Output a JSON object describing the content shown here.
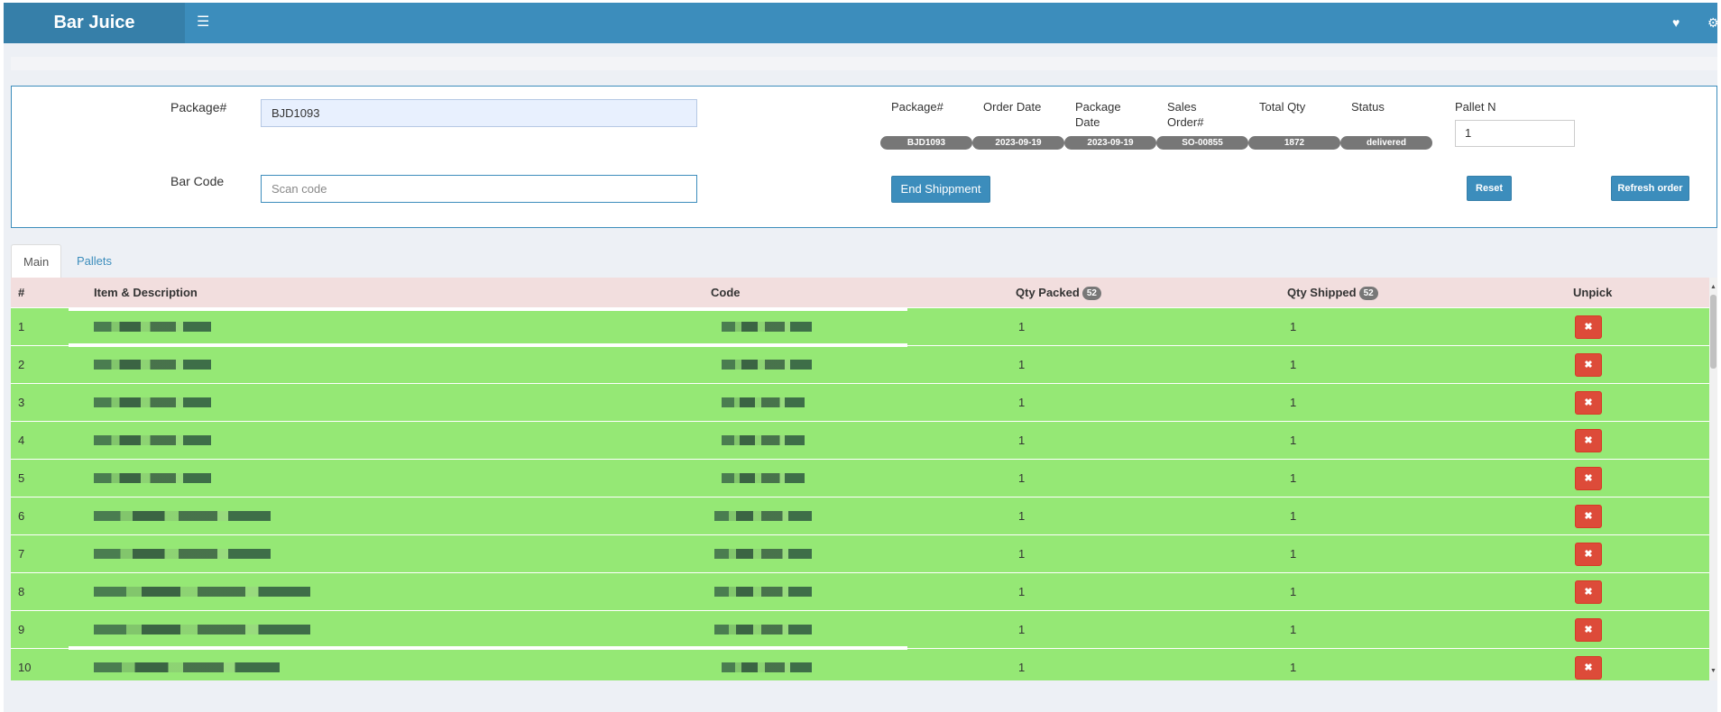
{
  "header": {
    "brand": "Bar Juice",
    "menu_icon": "bars-icon",
    "icons": [
      "heart-icon",
      "gear-icon"
    ]
  },
  "form": {
    "package_label": "Package#",
    "package_value": "BJD1093",
    "barcode_label": "Bar Code",
    "barcode_placeholder": "Scan code"
  },
  "summary": {
    "headers": {
      "package": "Package#",
      "order_date": "Order Date",
      "package_date": "Package Date",
      "sales_order": "Sales Order#",
      "total_qty": "Total Qty",
      "status": "Status",
      "pallet": "Pallet N"
    },
    "values": {
      "package": "BJD1093",
      "order_date": "2023-09-19",
      "package_date": "2023-09-19",
      "sales_order": "SO-00855",
      "total_qty": "1872",
      "status": "delivered",
      "pallet": "1"
    }
  },
  "buttons": {
    "end_shipment": "End Shippment",
    "reset": "Reset",
    "refresh": "Refresh order"
  },
  "tabs": {
    "main": "Main",
    "pallets": "Pallets"
  },
  "table": {
    "headers": {
      "num": "#",
      "item": "Item & Description",
      "code": "Code",
      "qty_packed": "Qty Packed",
      "qty_packed_badge": "52",
      "qty_shipped": "Qty Shipped",
      "qty_shipped_badge": "52",
      "unpick": "Unpick"
    },
    "unpick_icon": "close-icon",
    "rows": [
      {
        "num": "1",
        "qty_packed": "1",
        "qty_shipped": "1"
      },
      {
        "num": "2",
        "qty_packed": "1",
        "qty_shipped": "1"
      },
      {
        "num": "3",
        "qty_packed": "1",
        "qty_shipped": "1"
      },
      {
        "num": "4",
        "qty_packed": "1",
        "qty_shipped": "1"
      },
      {
        "num": "5",
        "qty_packed": "1",
        "qty_shipped": "1"
      },
      {
        "num": "6",
        "qty_packed": "1",
        "qty_shipped": "1"
      },
      {
        "num": "7",
        "qty_packed": "1",
        "qty_shipped": "1"
      },
      {
        "num": "8",
        "qty_packed": "1",
        "qty_shipped": "1"
      },
      {
        "num": "9",
        "qty_packed": "1",
        "qty_shipped": "1"
      },
      {
        "num": "10",
        "qty_packed": "1",
        "qty_shipped": "1"
      }
    ]
  },
  "colors": {
    "header": "#3c8dbc",
    "logo_bg": "#367fa9",
    "row_bg": "#95e875",
    "thead_bg": "#f2dede",
    "danger": "#dd4b39",
    "badge": "#777777"
  }
}
